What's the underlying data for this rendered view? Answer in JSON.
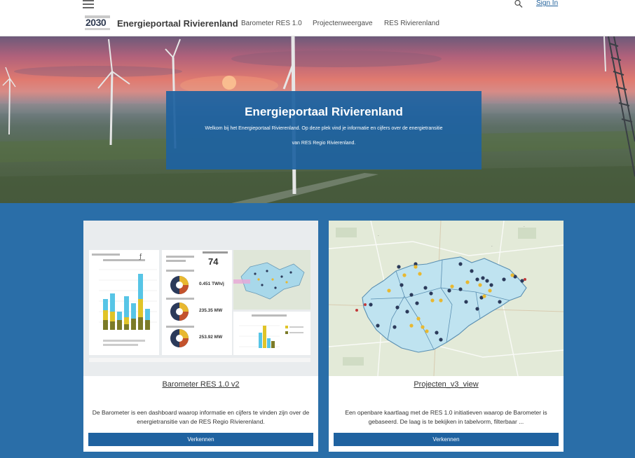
{
  "header": {
    "logo_number": "2030",
    "site_title": "Energieportaal Rivierenland",
    "nav": [
      "Barometer RES 1.0",
      "Projectenweergave",
      "RES Rivierenland"
    ],
    "sign_in": "Sign In"
  },
  "hero": {
    "title": "Energieportaal Rivierenland",
    "text": "Welkom bij het Energieportaal Rivierenland. Op deze plek vind je informatie en cijfers over de energietransitie van RES Regio Rivierenland."
  },
  "cards": [
    {
      "title": "Barometer RES 1.0 v2",
      "description": "De Barometer is een dashboard waarop informatie en cijfers te vinden zijn over de energietransitie van de RES Regio Rivierenland.",
      "button": "Verkennen",
      "dashboard": {
        "kpi_big": "74",
        "kpis": [
          "0.451 TWh/j",
          "235.35 MW",
          "253.92 MW"
        ]
      }
    },
    {
      "title": "Projecten_v3_view",
      "description": "Een openbare kaartlaag met de RES 1.0 initiatieven waarop de Barometer is gebaseerd. De laag is te bekijken in tabelvorm, filterbaar ...",
      "button": "Verkennen"
    }
  ],
  "colors": {
    "primary_blue": "#2a6ea8",
    "button_blue": "#1f62a0",
    "map_region": "#bfe3f0",
    "point_dark": "#2b3a5a",
    "point_yellow": "#e8b830"
  }
}
